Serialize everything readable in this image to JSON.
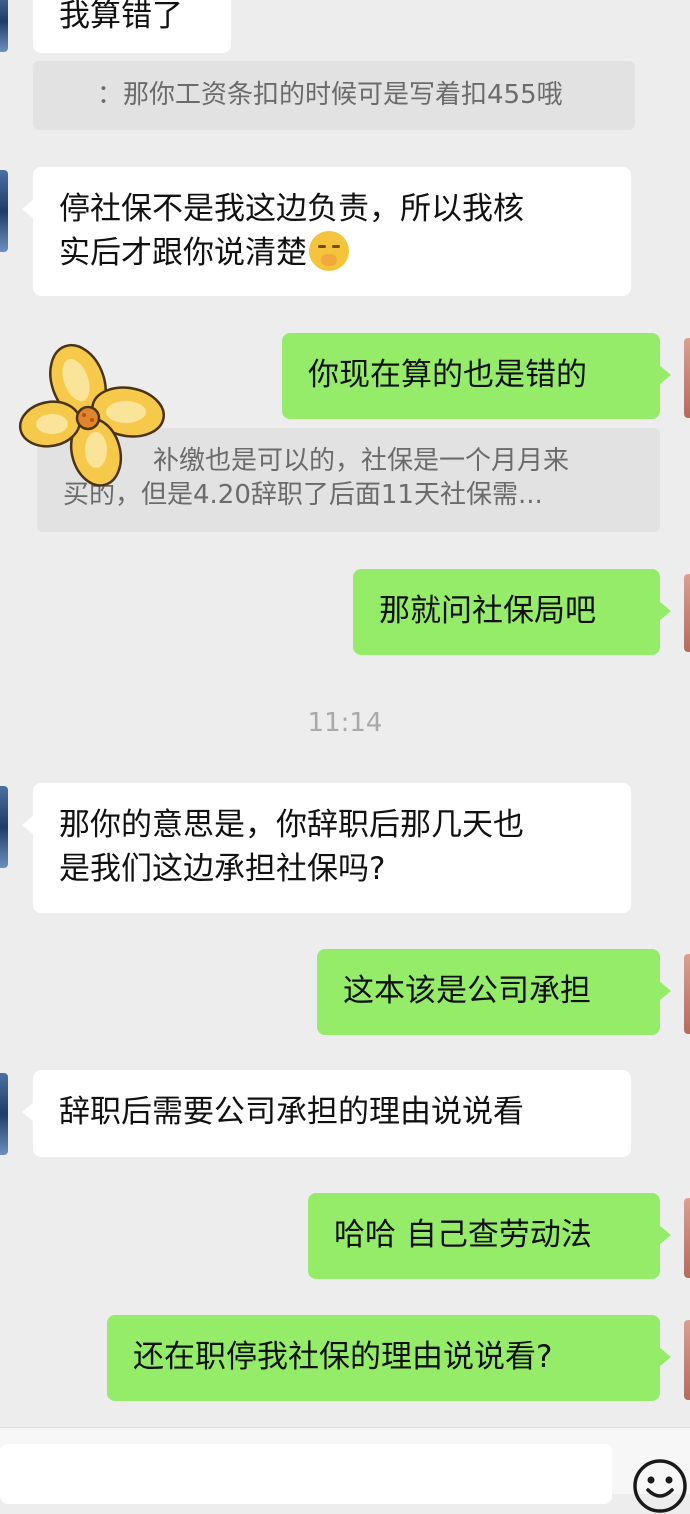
{
  "messages": {
    "m1": "我算错了",
    "q1": "：那你工资条扣的时候可是写着扣455哦",
    "m2_line1": "停社保不是我这边负责，所以我核",
    "m2_line2": "实后才跟你说清楚",
    "m3": "你现在算的也是错的",
    "q2_line1": "补缴也是可以的，社保是一个月月来",
    "q2_line2": "买的，但是4.20辞职了后面11天社保需...",
    "m4": "那就问社保局吧",
    "time": "11:14",
    "m5_line1": "那你的意思是，你辞职后那几天也",
    "m5_line2": "是我们这边承担社保吗?",
    "m6": "这本该是公司承担",
    "m7": "辞职后需要公司承担的理由说说看",
    "m8": "哈哈 自己查劳动法",
    "m9": "还在职停我社保的理由说说看?"
  },
  "icons": {
    "emoji_in_message": "face-with-hand-over-mouth-emoji",
    "sticker": "yellow-flower-sticker",
    "input_emoji_button": "smiley-face-icon"
  },
  "colors": {
    "background": "#ededed",
    "incoming_bubble": "#ffffff",
    "outgoing_bubble": "#95ec69",
    "quote_bg": "#e2e2e2"
  }
}
